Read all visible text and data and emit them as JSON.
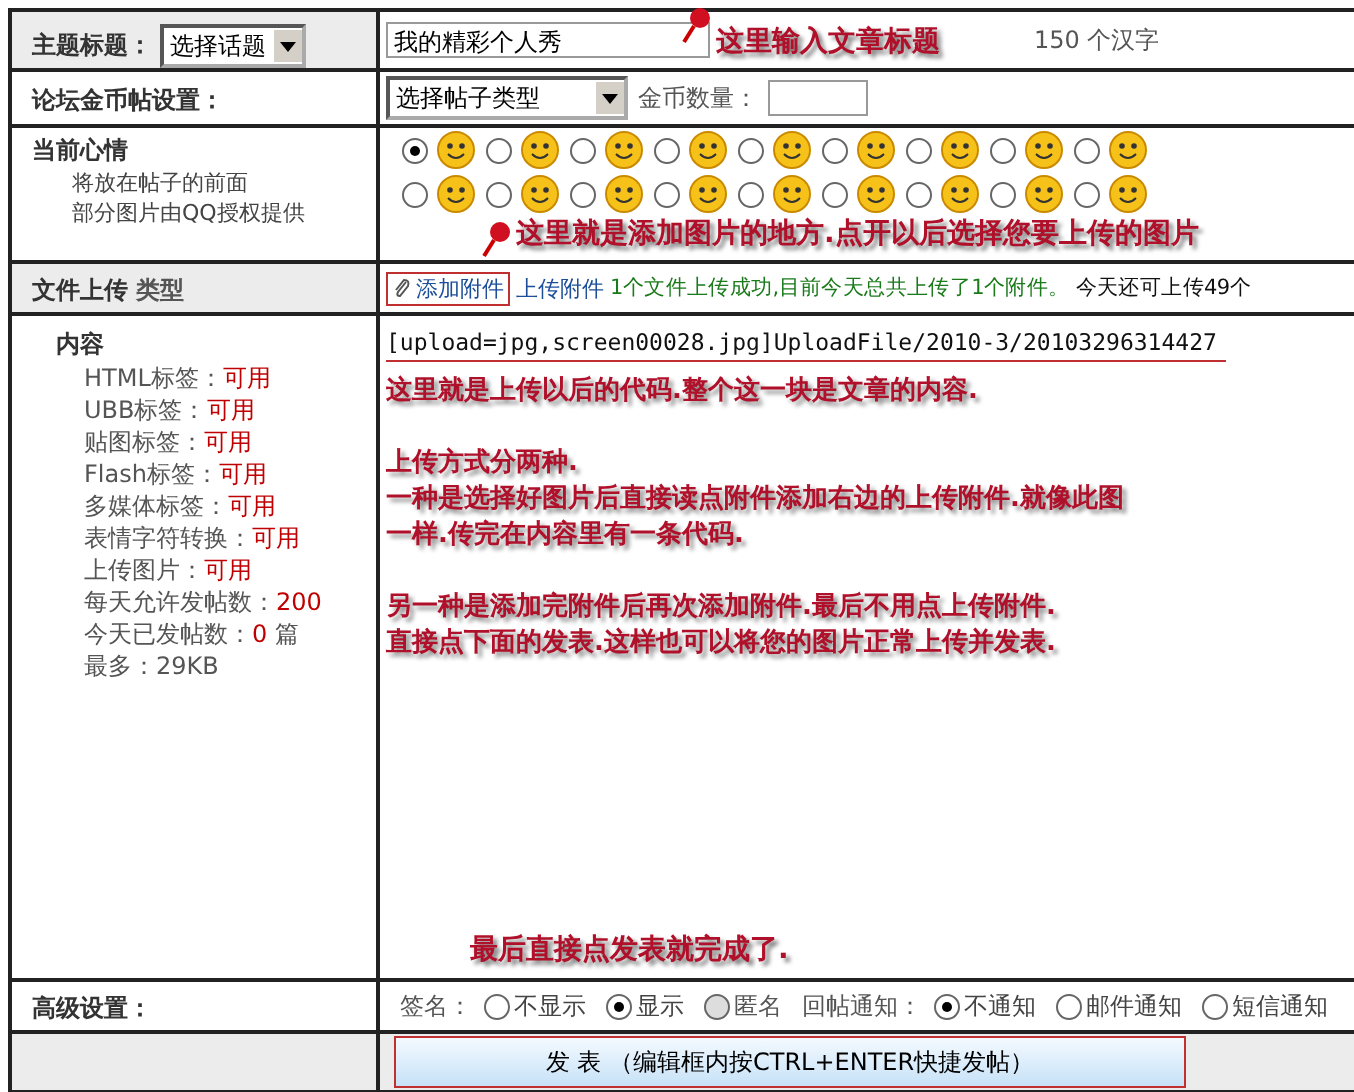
{
  "title_row": {
    "label": "主题标题：",
    "topic_select": "选择话题",
    "title_value": "我的精彩个人秀",
    "limit_note": "150 个汉字"
  },
  "coin_row": {
    "label": "论坛金币帖设置：",
    "type_select": "选择帖子类型",
    "amount_label": "金币数量："
  },
  "mood_row": {
    "label": "当前心情",
    "notes": [
      "将放在帖子的前面",
      "部分图片由QQ授权提供"
    ],
    "moods": [
      {
        "selected": true
      },
      {
        "selected": false
      },
      {
        "selected": false
      },
      {
        "selected": false
      },
      {
        "selected": false
      },
      {
        "selected": false
      },
      {
        "selected": false
      },
      {
        "selected": false
      },
      {
        "selected": false
      },
      {
        "selected": false
      },
      {
        "selected": false
      },
      {
        "selected": false
      },
      {
        "selected": false
      },
      {
        "selected": false
      },
      {
        "selected": false
      },
      {
        "selected": false
      },
      {
        "selected": false
      },
      {
        "selected": false
      }
    ]
  },
  "upload_row": {
    "label": "文件上传",
    "sublabel": "类型",
    "add_link": "添加附件",
    "upload_link": "上传附件",
    "success": "1个文件上传成功,目前今天总共上传了1个附件。",
    "remaining": "今天还可上传49个"
  },
  "content_row": {
    "label": "内容",
    "rules": [
      {
        "name": "HTML标签：",
        "value": "可用",
        "kind": "status"
      },
      {
        "name": "UBB标签：",
        "value": "可用",
        "kind": "status"
      },
      {
        "name": "贴图标签：",
        "value": "可用",
        "kind": "status"
      },
      {
        "name": "Flash标签：",
        "value": "可用",
        "kind": "status"
      },
      {
        "name": "多媒体标签：",
        "value": "可用",
        "kind": "status"
      },
      {
        "name": "表情字符转换：",
        "value": "可用",
        "kind": "status"
      },
      {
        "name": "上传图片：",
        "value": "可用",
        "kind": "status"
      },
      {
        "name": "每天允许发帖数：",
        "value": "200",
        "kind": "status"
      },
      {
        "name": "今天已发帖数：",
        "value": "0",
        "unit": "篇",
        "kind": "status"
      },
      {
        "name": "最多：",
        "value": "29KB",
        "kind": "plain"
      }
    ],
    "code": "[upload=jpg,screen00028.jpg]UploadFile/2010-3/20103296314427",
    "notes": [
      [
        "这里就是上传以后的代码.整个这一块是文章的内容."
      ],
      [
        "上传方式分两种.",
        "一种是选择好图片后直接读点附件添加右边的上传附件.就像此图",
        "一样.传完在内容里有一条代码."
      ],
      [
        "另一种是添加完附件后再次添加附件.最后不用点上传附件.",
        "直接点下面的发表.这样也可以将您的图片正常上传并发表."
      ]
    ]
  },
  "advanced_row": {
    "label": "高级设置：",
    "sign_label": "签名：",
    "sign_options": [
      {
        "label": "不显示",
        "checked": false,
        "disabled": false
      },
      {
        "label": "显示",
        "checked": true,
        "disabled": false
      },
      {
        "label": "匿名",
        "checked": false,
        "disabled": true
      }
    ],
    "notify_label": "回帖通知：",
    "notify_options": [
      {
        "label": "不通知",
        "checked": true,
        "disabled": false
      },
      {
        "label": "邮件通知",
        "checked": false,
        "disabled": false
      },
      {
        "label": "短信通知",
        "checked": false,
        "disabled": false
      }
    ]
  },
  "submit_button": "发 表 （编辑框内按CTRL+ENTER快捷发帖）",
  "annotations": {
    "title_hint": "这里输入文章标题",
    "image_hint": "这里就是添加图片的地方.点开以后选择您要上传的图片",
    "final_hint": "最后直接点发表就完成了."
  }
}
